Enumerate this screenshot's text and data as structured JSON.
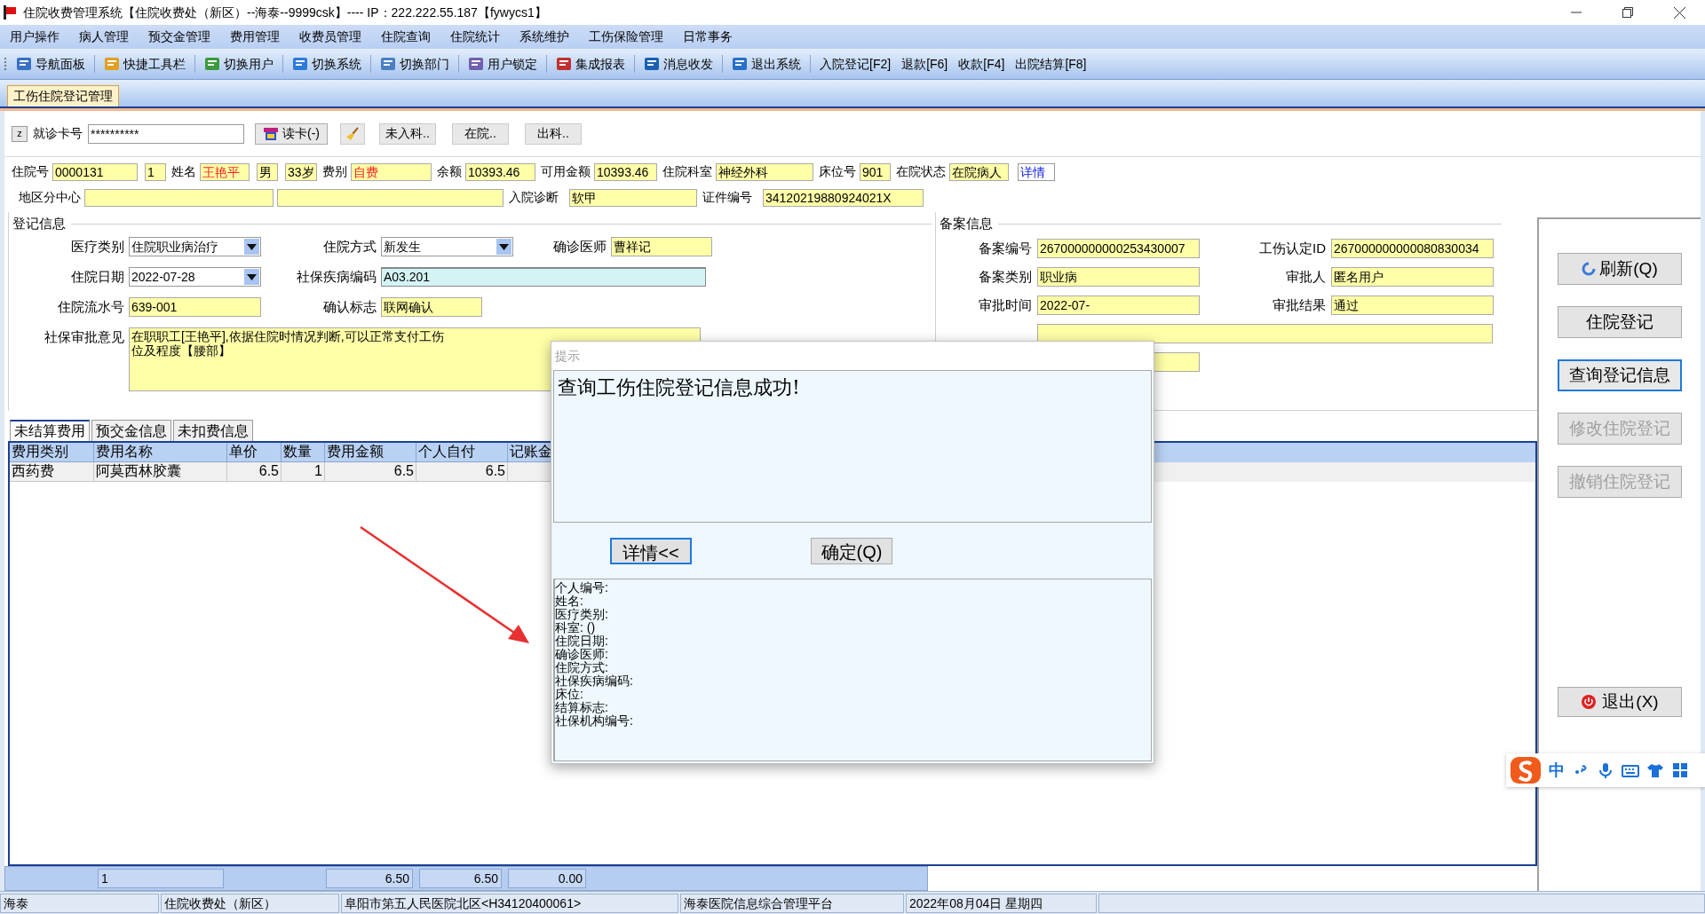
{
  "window": {
    "title": "住院收费管理系统【住院收费处（新区）--海泰--9999csk】---- IP：222.222.55.187【fywycs1】"
  },
  "menu": [
    "用户操作",
    "病人管理",
    "预交金管理",
    "费用管理",
    "收费员管理",
    "住院查询",
    "住院统计",
    "系统维护",
    "工伤保险管理",
    "日常事务"
  ],
  "toolbar": [
    {
      "kind": "icon",
      "label": "导航面板"
    },
    {
      "kind": "icon",
      "label": "快捷工具栏"
    },
    {
      "kind": "icon",
      "label": "切换用户"
    },
    {
      "kind": "icon",
      "label": "切换系统"
    },
    {
      "kind": "icon",
      "label": "切换部门"
    },
    {
      "kind": "icon",
      "label": "用户锁定"
    },
    {
      "kind": "icon",
      "label": "集成报表"
    },
    {
      "kind": "icon",
      "label": "消息收发"
    },
    {
      "kind": "icon",
      "label": "退出系统"
    },
    {
      "kind": "text",
      "label": "入院登记[F2]"
    },
    {
      "kind": "text",
      "label": "退款[F6]"
    },
    {
      "kind": "text",
      "label": "收款[F4]"
    },
    {
      "kind": "text",
      "label": "出院结算[F8]"
    }
  ],
  "tabs": [
    {
      "label": "工伤住院登记管理",
      "selected": true
    }
  ],
  "card_bar": {
    "clear_button": "z",
    "label": "就诊卡号",
    "value": "**********",
    "read_card_button": "读卡(-)",
    "buttons": [
      "未入科..",
      "在院..",
      "出科.."
    ]
  },
  "patient_info": [
    [
      {
        "kind": "field",
        "label": "住院号",
        "value": "0000131",
        "red": false
      },
      {
        "kind": "field",
        "value": "1",
        "red": false
      },
      {
        "kind": "field",
        "label": "姓名",
        "value": "王艳平",
        "red": true
      },
      {
        "kind": "field",
        "value": "男",
        "red": false
      },
      {
        "kind": "field",
        "value": "33岁",
        "red": false
      },
      {
        "kind": "field",
        "label": "费别",
        "value": "自费",
        "red": true
      },
      {
        "kind": "field",
        "label": "余额",
        "value": "10393.46",
        "red": false
      },
      {
        "kind": "field",
        "label": "可用金额",
        "value": "10393.46",
        "red": false
      },
      {
        "kind": "field",
        "label": "住院科室",
        "value": "神经外科",
        "red": false
      },
      {
        "kind": "field",
        "label": "床位号",
        "value": "901",
        "red": false
      },
      {
        "kind": "field",
        "label": "在院状态",
        "value": "在院病人",
        "red": false
      },
      {
        "kind": "link",
        "value": "详情"
      }
    ],
    [
      {
        "kind": "field",
        "label": "地区分中心"
      },
      {
        "kind": "field"
      },
      {
        "kind": "field",
        "label": "入院诊断",
        "value": "软甲",
        "red": false
      },
      {
        "kind": "field",
        "label": "证件编号",
        "value": "34120219880924021X",
        "red": false
      }
    ]
  ],
  "registration": {
    "title": "登记信息",
    "rows": [
      [
        {
          "kind": "combo",
          "label": "医疗类别",
          "value": "住院职业病治疗"
        },
        {
          "kind": "combo",
          "label": "住院方式",
          "value": "新发生"
        },
        {
          "kind": "field",
          "label": "确诊医师",
          "value": "曹祥记"
        }
      ],
      [
        {
          "kind": "combo",
          "label": "住院日期",
          "value": "2022-07-28"
        },
        {
          "kind": "edit",
          "label": "社保疾病编码",
          "value": "A03.201"
        }
      ],
      [
        {
          "kind": "field",
          "label": "住院流水号",
          "value": "639-001"
        },
        {
          "kind": "field",
          "label": "确认标志",
          "value": "联网确认"
        }
      ],
      [
        {
          "kind": "memo",
          "label": "社保审批意见",
          "lines": [
            "在职职工[王艳平],依据住院时情况判断,可以正常支付工伤",
            "位及程度【腰部】"
          ]
        }
      ]
    ]
  },
  "filing": {
    "title": "备案信息",
    "rows": [
      [
        {
          "kind": "field",
          "label": "备案编号",
          "value": "267000000000253430007"
        },
        {
          "kind": "field",
          "label": "工伤认定ID",
          "value": "267000000000080830034"
        }
      ],
      [
        {
          "kind": "field",
          "label": "备案类别",
          "value": "职业病"
        },
        {
          "kind": "field",
          "label": "审批人",
          "value": "匿名用户"
        }
      ],
      [
        {
          "kind": "field",
          "label": "审批时间",
          "value": "2022-07-"
        },
        {
          "kind": "field",
          "label": "审批结果",
          "value": "通过"
        }
      ],
      [
        {
          "kind": "wide"
        }
      ],
      [
        {
          "kind": "field"
        }
      ]
    ]
  },
  "actions": [
    {
      "label": "刷新(Q)",
      "disabled": false,
      "focused": false
    },
    {
      "label": "住院登记",
      "disabled": false,
      "focused": false
    },
    {
      "label": "查询登记信息",
      "disabled": false,
      "focused": true
    },
    {
      "label": "修改住院登记",
      "disabled": true,
      "focused": false
    },
    {
      "label": "撤销住院登记",
      "disabled": true,
      "focused": false
    }
  ],
  "exit_button": {
    "label": "退出(X)"
  },
  "fee_tabs": [
    {
      "label": "未结算费用",
      "selected": true
    },
    {
      "label": "预交金信息",
      "selected": false
    },
    {
      "label": "未扣费信息",
      "selected": false
    }
  ],
  "fee_table": {
    "columns": [
      "费用类别",
      "费用名称",
      "单价",
      "数量",
      "费用金额",
      "个人自付",
      "记账金"
    ],
    "rows": [
      [
        "西药费",
        "阿莫西林胶囊",
        "6.5",
        "1",
        "6.5",
        "6.5"
      ]
    ]
  },
  "totals": [
    "1",
    "6.50",
    "6.50",
    "0.00"
  ],
  "dialog": {
    "title": "提示",
    "message": "查询工伤住院登记信息成功!",
    "buttons": [
      {
        "label": "详情<<",
        "focused": true
      },
      {
        "label": "确定(Q)",
        "focused": false
      }
    ],
    "details": [
      "个人编号:",
      "姓名:",
      "医疗类别:",
      "科室: ()",
      "住院日期:",
      "确诊医师:",
      "住院方式:",
      "社保疾病编码:",
      "床位:",
      "结算标志:",
      "社保机构编号:"
    ]
  },
  "ime_toolbar": {
    "mode": "中"
  },
  "status_bar": [
    "海泰",
    "住院收费处（新区）",
    "阜阳市第五人民医院北区<H34120400061>",
    "海泰医院信息综合管理平台",
    "2022年08月04日 星期四"
  ]
}
